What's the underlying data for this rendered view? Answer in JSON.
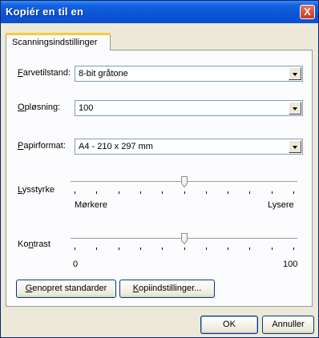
{
  "window": {
    "title": "Kopiér en til en",
    "close_label": "X"
  },
  "tabs": [
    {
      "label": "Scanningsindstillinger"
    }
  ],
  "fields": {
    "color_mode": {
      "label_mnemonic": "F",
      "label_rest": "arvetilstand:",
      "value": "8-bit gråtone"
    },
    "resolution": {
      "label_mnemonic": "O",
      "label_rest": "pløsning:",
      "value": "100"
    },
    "paper_size": {
      "label_mnemonic": "P",
      "label_rest": "apirformat:",
      "value": "A4 - 210 x 297 mm"
    }
  },
  "sliders": {
    "brightness": {
      "label_mnemonic": "L",
      "label_rest": "ysstyrke",
      "min_label": "Mørkere",
      "max_label": "Lysere",
      "ticks": 11,
      "position_fraction": 0.5
    },
    "contrast": {
      "label_pre": "Ko",
      "label_mnemonic": "n",
      "label_rest": "trast",
      "min_label": "0",
      "max_label": "100",
      "ticks": 11,
      "position_fraction": 0.5
    }
  },
  "buttons": {
    "restore": {
      "mnemonic": "G",
      "rest": "enopret standarder"
    },
    "copy_settings": {
      "mnemonic": "K",
      "rest": "opiindstillinger..."
    },
    "ok": {
      "label": "OK"
    },
    "cancel": {
      "label": "Annuller"
    }
  }
}
